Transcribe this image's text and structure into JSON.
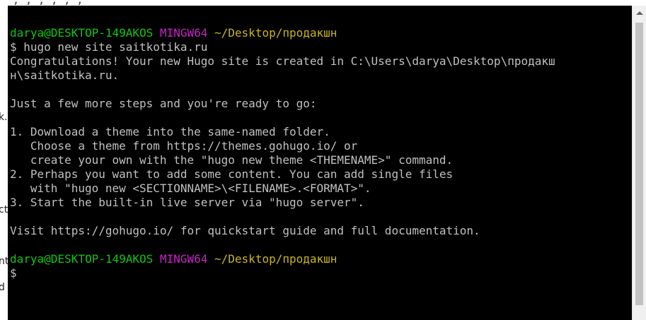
{
  "background": {
    "top_fragment": "  ,  ,  ,  ,  ,  ,  ,  ",
    "left_fragments": [
      "k.c",
      "cts",
      "nt",
      "d"
    ]
  },
  "terminal": {
    "lines": [
      {
        "kind": "prompt",
        "user": "darya@DESKTOP-149AKOS",
        "shell": "MINGW64",
        "path": "~/Desktop/продакшн"
      },
      {
        "kind": "text",
        "text": "$ hugo new site saitkotika.ru"
      },
      {
        "kind": "text",
        "text": "Congratulations! Your new Hugo site is created in C:\\Users\\darya\\Desktop\\продакш"
      },
      {
        "kind": "text",
        "text": "н\\saitkotika.ru."
      },
      {
        "kind": "text",
        "text": ""
      },
      {
        "kind": "text",
        "text": "Just a few more steps and you're ready to go:"
      },
      {
        "kind": "text",
        "text": ""
      },
      {
        "kind": "text",
        "text": "1. Download a theme into the same-named folder."
      },
      {
        "kind": "text",
        "text": "   Choose a theme from https://themes.gohugo.io/ or"
      },
      {
        "kind": "text",
        "text": "   create your own with the \"hugo new theme <THEMENAME>\" command."
      },
      {
        "kind": "text",
        "text": "2. Perhaps you want to add some content. You can add single files"
      },
      {
        "kind": "text",
        "text": "   with \"hugo new <SECTIONNAME>\\<FILENAME>.<FORMAT>\"."
      },
      {
        "kind": "text",
        "text": "3. Start the built-in live server via \"hugo server\"."
      },
      {
        "kind": "text",
        "text": ""
      },
      {
        "kind": "text",
        "text": "Visit https://gohugo.io/ for quickstart guide and full documentation."
      },
      {
        "kind": "text",
        "text": ""
      },
      {
        "kind": "prompt",
        "user": "darya@DESKTOP-149AKOS",
        "shell": "MINGW64",
        "path": "~/Desktop/продакшн"
      },
      {
        "kind": "text",
        "text": "$"
      }
    ]
  },
  "colors": {
    "background": "#000000",
    "text": "#c0c0c0",
    "user": "#12c312",
    "shell": "#c822c8",
    "path": "#c8b622"
  }
}
